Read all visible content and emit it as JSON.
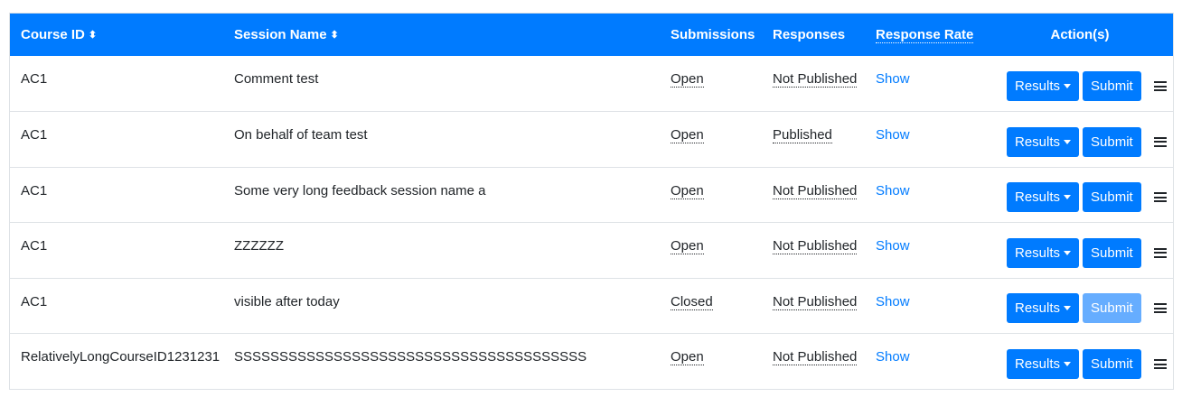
{
  "headers": {
    "course_id": "Course ID",
    "session_name": "Session Name",
    "submissions": "Submissions",
    "responses": "Responses",
    "response_rate": "Response Rate",
    "actions": "Action(s)"
  },
  "sort_glyph": "⬍",
  "rows": [
    {
      "course_id": "AC1",
      "session_name": "Comment test",
      "submissions": "Open",
      "responses": "Not Published",
      "response_rate": "Show",
      "results_label": "Results",
      "submit_label": "Submit",
      "submit_enabled": true
    },
    {
      "course_id": "AC1",
      "session_name": "On behalf of team test",
      "submissions": "Open",
      "responses": "Published",
      "response_rate": "Show",
      "results_label": "Results",
      "submit_label": "Submit",
      "submit_enabled": true
    },
    {
      "course_id": "AC1",
      "session_name": "Some very long feedback session name a",
      "submissions": "Open",
      "responses": "Not Published",
      "response_rate": "Show",
      "results_label": "Results",
      "submit_label": "Submit",
      "submit_enabled": true
    },
    {
      "course_id": "AC1",
      "session_name": "ZZZZZZ",
      "submissions": "Open",
      "responses": "Not Published",
      "response_rate": "Show",
      "results_label": "Results",
      "submit_label": "Submit",
      "submit_enabled": true
    },
    {
      "course_id": "AC1",
      "session_name": "visible after today",
      "submissions": "Closed",
      "responses": "Not Published",
      "response_rate": "Show",
      "results_label": "Results",
      "submit_label": "Submit",
      "submit_enabled": false
    },
    {
      "course_id": "RelativelyLongCourseID1231231",
      "session_name": "SSSSSSSSSSSSSSSSSSSSSSSSSSSSSSSSSSSSSSS",
      "submissions": "Open",
      "responses": "Not Published",
      "response_rate": "Show",
      "results_label": "Results",
      "submit_label": "Submit",
      "submit_enabled": true
    }
  ],
  "colors": {
    "primary": "#007bff",
    "primary_disabled": "#66adff",
    "border": "#dee2e6"
  }
}
